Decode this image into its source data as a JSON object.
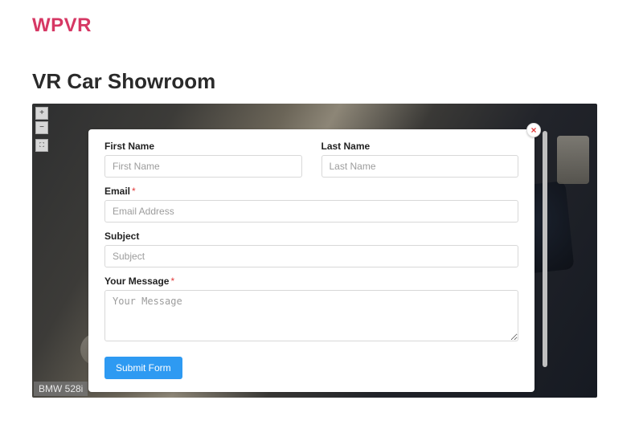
{
  "site_title": "WPVR",
  "page_title": "VR Car Showroom",
  "vr": {
    "zoom_in": "+",
    "zoom_out": "−",
    "fullscreen": "⛶",
    "caption": "BMW 528i"
  },
  "modal": {
    "close": "×",
    "fields": {
      "first_name": {
        "label": "First Name",
        "placeholder": "First Name"
      },
      "last_name": {
        "label": "Last Name",
        "placeholder": "Last Name"
      },
      "email": {
        "label": "Email",
        "placeholder": "Email Address",
        "required": "*"
      },
      "subject": {
        "label": "Subject",
        "placeholder": "Subject"
      },
      "message": {
        "label": "Your Message",
        "placeholder": "Your Message",
        "required": "*"
      }
    },
    "submit": "Submit Form"
  }
}
